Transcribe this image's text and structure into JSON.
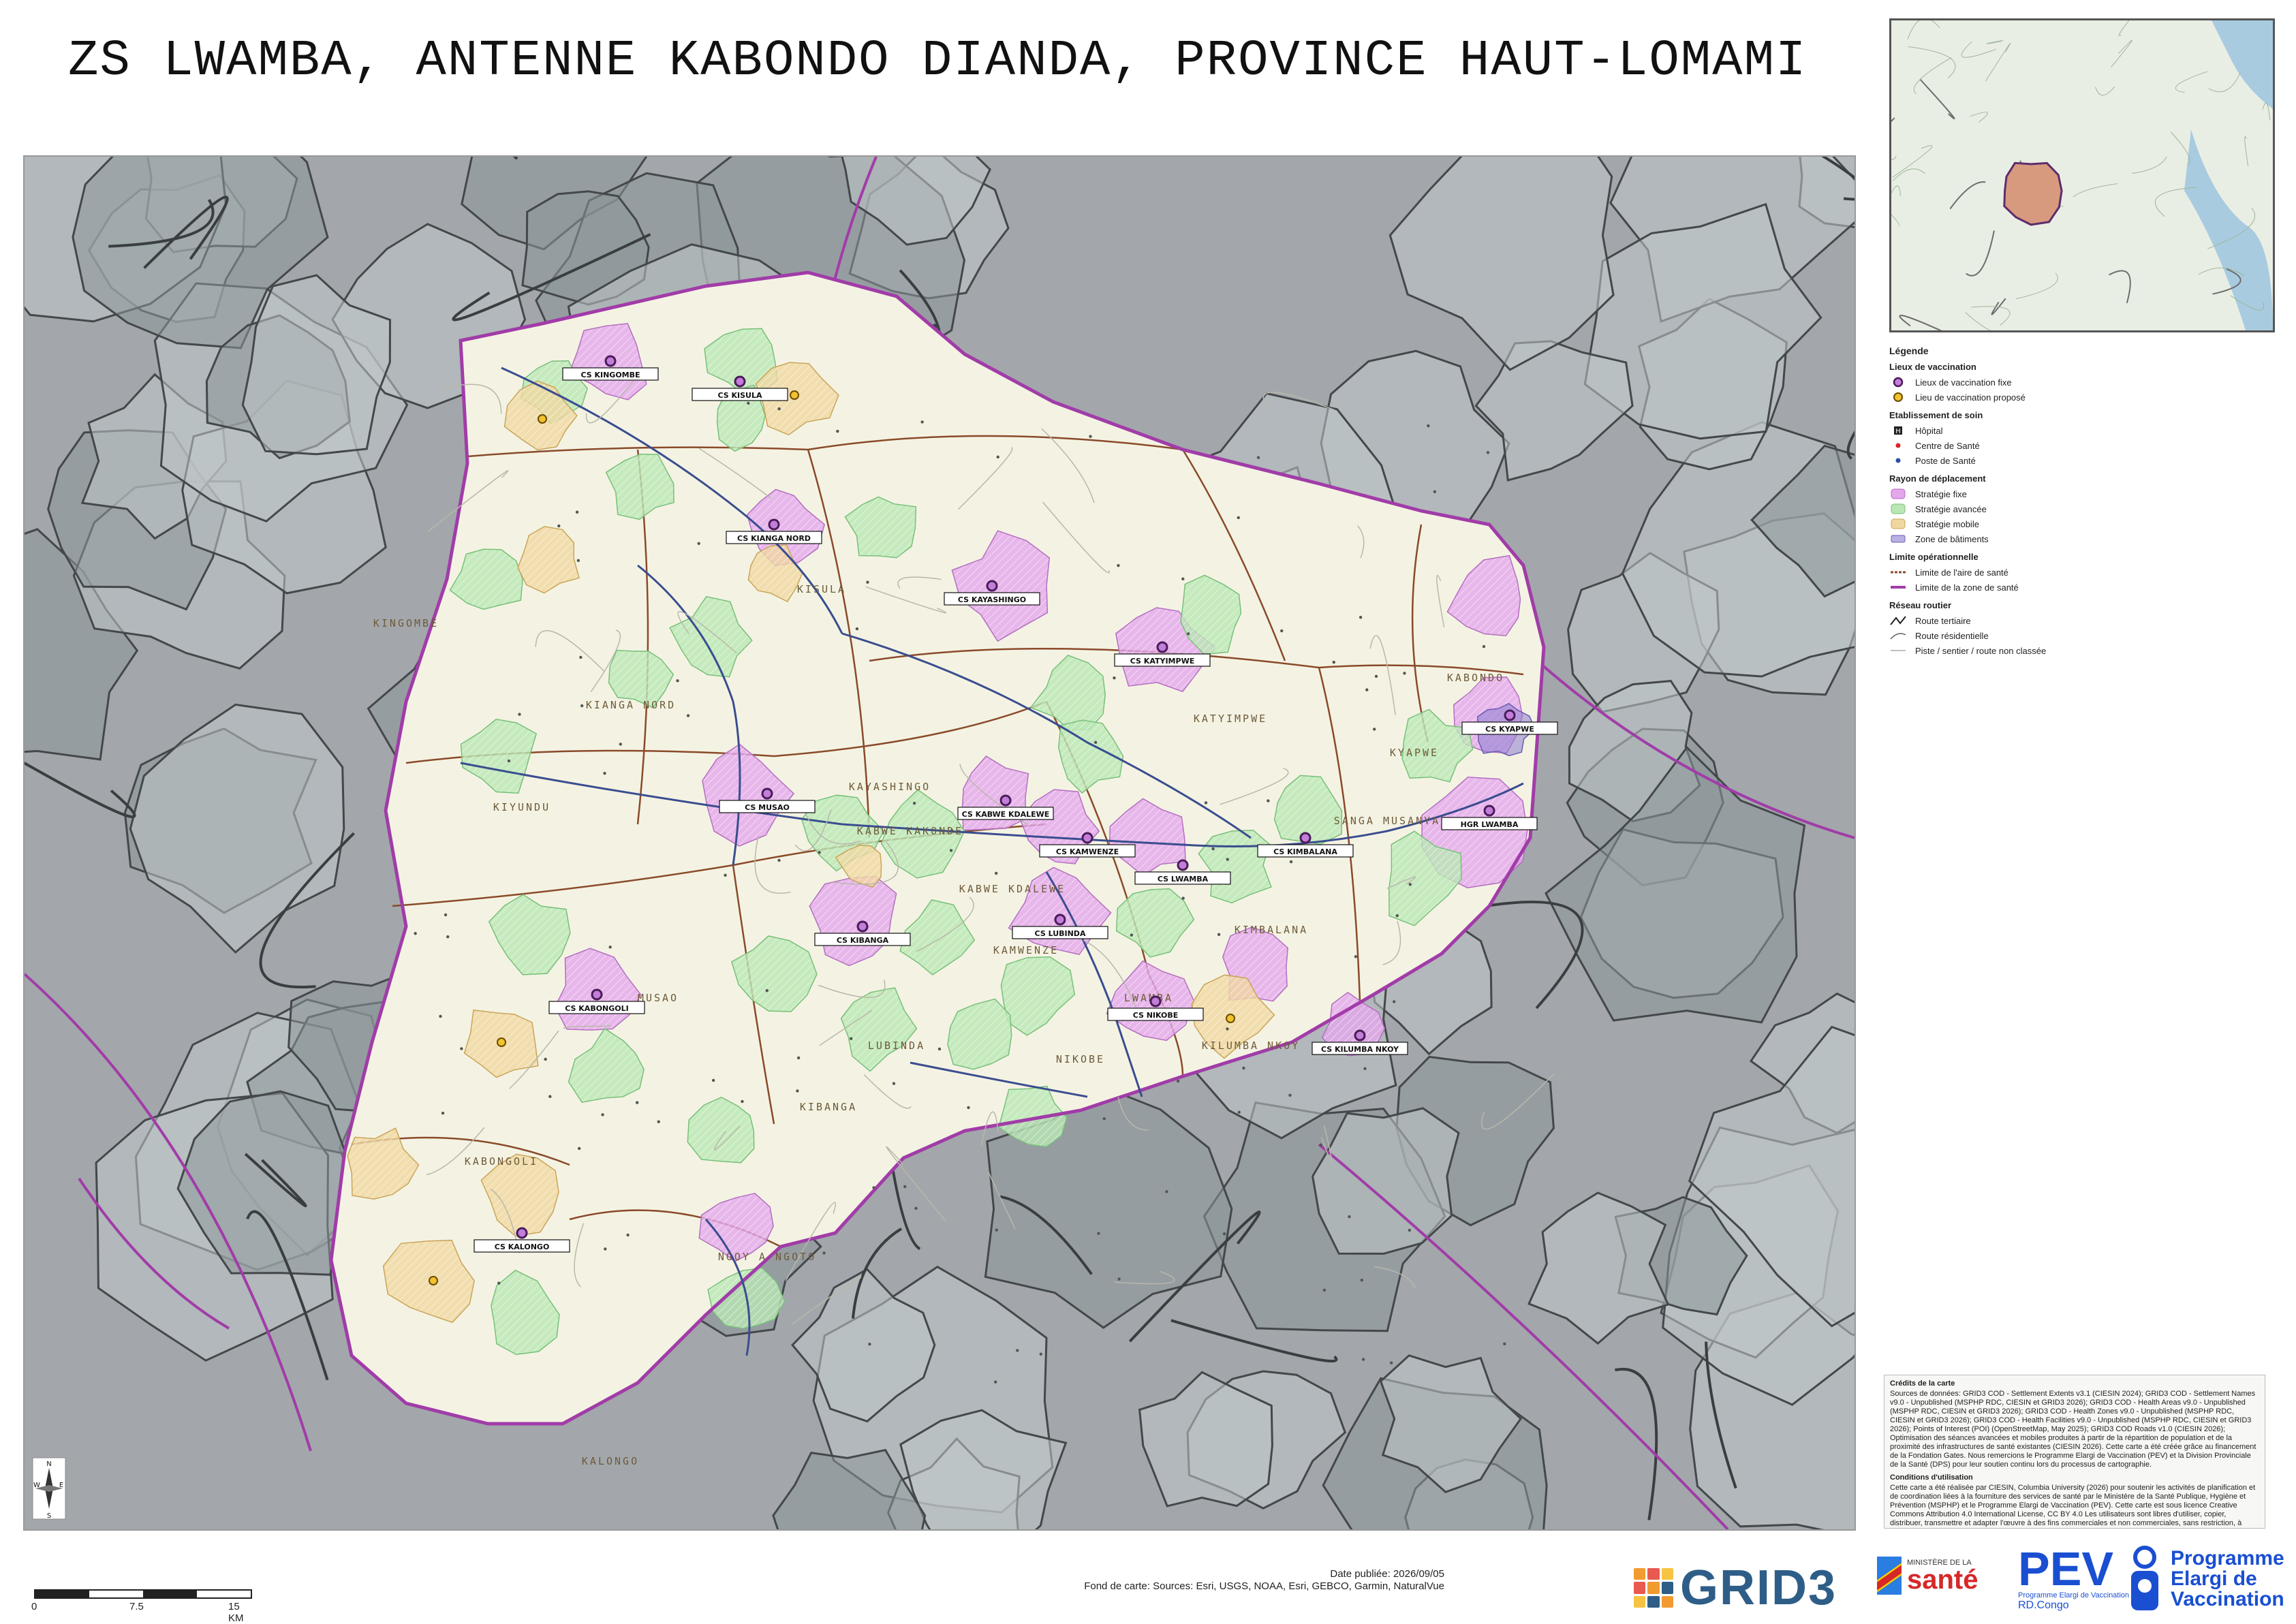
{
  "title": "ZS LWAMBA, ANTENNE KABONDO DIANDA, PROVINCE HAUT-LOMAMI",
  "colors": {
    "outside": "#a3a7ab",
    "outside_dark": "#5b6368",
    "zone_fill": "#f4f3e3",
    "zone_border": "#a13ca8",
    "aire_border": "#8a4a2a",
    "fixe": "#e4a6ec",
    "avancee": "#b9e7b4",
    "mobile": "#f0d7a0",
    "batiments": "#8a7bd0",
    "road": "#3a4d8f"
  },
  "map": {
    "zone_name": "LWAMBA",
    "aires": [
      "KINGOMBE",
      "KISULA",
      "KIANGA NORD",
      "KIYUNDU",
      "MUSAO",
      "KAYASHINGO",
      "KABWE KAKONDE",
      "KABWE KDALEWE",
      "KAMWENZE",
      "LWAMBA",
      "KIMBALANA",
      "SANGA MUSANYA",
      "KATYIMPWE",
      "KYAPWE",
      "KABONDO",
      "LUBINDA",
      "NIKOBE",
      "KILUMBA NKOY",
      "KIBANGA",
      "KABONGOLI",
      "NGOY A NGOTO",
      "KALONGO"
    ],
    "sites": [
      "CS KINGOMBE",
      "CS KISULA",
      "CS KIANGA NORD",
      "CS KAYASHINGO",
      "CS MUSAO",
      "CS KATYIMPWE",
      "CS KABWE KDALEWE",
      "CS KAMWENZE",
      "CS LWAMBA",
      "CS KIMBALANA",
      "CS NIKOBE",
      "CS LUBINDA",
      "CS KIBANGA",
      "CS KABONGOLI",
      "CS KALONGO",
      "CS KILUMBA NKOY",
      "CS KYAPWE",
      "HGR LWAMBA"
    ]
  },
  "legend": {
    "title": "Légende",
    "sections": [
      {
        "heading": "Lieux de vaccination",
        "items": [
          {
            "label": "Lieux de vaccination fixe",
            "icon": "circle-purple"
          },
          {
            "label": "Lieu de vaccination proposé",
            "icon": "circle-yellow"
          }
        ]
      },
      {
        "heading": "Etablissement de soin",
        "items": [
          {
            "label": "Hôpital",
            "icon": "hospital-square"
          },
          {
            "label": "Centre de Santé",
            "icon": "star-red"
          },
          {
            "label": "Poste de Santé",
            "icon": "star-blue"
          }
        ]
      },
      {
        "heading": "Rayon de déplacement",
        "items": [
          {
            "label": "Stratégie fixe",
            "icon": "patch-fixe"
          },
          {
            "label": "Stratégie avancée",
            "icon": "patch-avancee"
          },
          {
            "label": "Stratégie mobile",
            "icon": "patch-mobile"
          },
          {
            "label": "Zone de bâtiments",
            "icon": "patch-batiments"
          }
        ]
      },
      {
        "heading": "Limite opérationnelle",
        "items": [
          {
            "label": "Limite de l'aire de santé",
            "icon": "line-aire"
          },
          {
            "label": "Limite de la zone de santé",
            "icon": "line-zone"
          }
        ]
      },
      {
        "heading": "Réseau routier",
        "items": [
          {
            "label": "Route tertiaire",
            "icon": "line-tertiaire"
          },
          {
            "label": "Route résidentielle",
            "icon": "line-residentielle"
          },
          {
            "label": "Piste / sentier / route non classée",
            "icon": "line-piste"
          }
        ]
      }
    ]
  },
  "credits": {
    "title": "Crédits de la carte",
    "sources": "Sources de données: GRID3 COD - Settlement Extents v3.1 (CIESIN 2024); GRID3 COD - Settlement Names v9.0 - Unpublished (MSPHP RDC, CIESIN et GRID3 2026); GRID3 COD - Health Areas v9.0 - Unpublished (MSPHP RDC, CIESIN et GRID3 2026); GRID3 COD - Health Zones v9.0 - Unpublished (MSPHP RDC, CIESIN et GRID3 2026); GRID3 COD - Health Facilities v9.0 - Unpublished (MSPHP RDC, CIESIN et GRID3 2026); Points of Interest (POI) (OpenStreetMap, May 2025); GRID3 COD Roads v1.0 (CIESIN 2026); Optimisation des séances avancées et mobiles produites à partir de la répartition de population et de la proximité des infrastructures de santé existantes (CIESIN 2026). Cette carte a été créée grâce au financement de la Fondation Gates. Nous remercions le Programme Elargi de Vaccination (PEV) et la Division Provinciale de la Santé (DPS) pour leur soutien continu lors du processus de cartographie.",
    "conditions_title": "Conditions d'utilisation",
    "conditions": "Cette carte a été réalisée par CIESIN, Columbia University (2026) pour soutenir les activités de planification et de coordination liées à la fourniture des services de santé par le Ministère de la Santé Publique, Hygiène et Prévention (MSPHP) et le Programme Elargi de Vaccination (PEV). Cette carte est sous licence Creative Commons Attribution 4.0 International License, CC BY 4.0 Les utilisateurs sont libres d'utiliser, copier, distribuer, transmettre et adapter l'œuvre à des fins commerciales et non commerciales, sans restriction, à condition qu'une attribution claire de la source soit fournie."
  },
  "scalebar": {
    "labels": [
      "0",
      "7.5",
      "15 KM"
    ]
  },
  "footer": {
    "date": "Date publiée: 2026/09/05",
    "basemap": "Fond de carte: Sources: Esri, USGS, NOAA, Esri, GEBCO, Garmin, NaturalVue"
  },
  "logos": {
    "grid3": "GRID3",
    "sante_small": "MINISTÈRE DE LA",
    "sante_big": "santé",
    "pev_big": "PEV",
    "pev_small": "Programme Elargi de Vaccination",
    "pev_rdc": "RD.Congo",
    "prog_lines": [
      "Programme",
      "Elargi de",
      "Vaccination"
    ]
  },
  "compass": {
    "n": "N",
    "s": "S",
    "e": "E",
    "w": "W"
  }
}
